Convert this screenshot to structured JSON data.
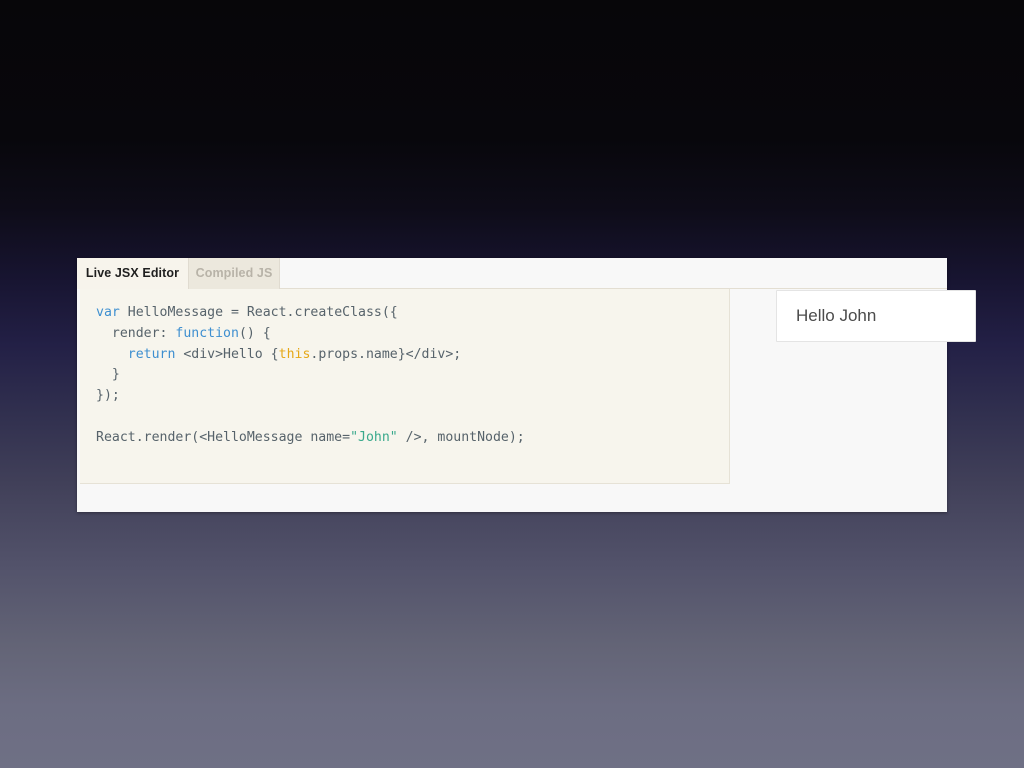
{
  "slide": {
    "background_top_color": "#070609",
    "background_bottom_color": "#6f7085"
  },
  "editor": {
    "tabs": [
      {
        "label": "Live JSX Editor",
        "active": true
      },
      {
        "label": "Compiled JS",
        "active": false
      }
    ],
    "code_pane": {
      "background_color": "#f7f5ed",
      "lines": [
        "var HelloMessage = React.createClass({",
        "  render: function() {",
        "    return <div>Hello {this.props.name}</div>;",
        "  }",
        "});",
        "",
        "React.render(<HelloMessage name=\"John\" />, mountNode);"
      ],
      "syntax_colors": {
        "keyword": "#3e8fd0",
        "this": "#e6a817",
        "string": "#3aa98c",
        "plain": "#57636b"
      },
      "tokens": {
        "kw_var": "var",
        "kw_function": "function",
        "kw_return": "return",
        "this_token": "this",
        "string_john": "\"John\""
      },
      "code_segments": {
        "line1_after_var": " HelloMessage = React.createClass({",
        "line2_before_fn": "  render: ",
        "line2_after_fn": "() {",
        "line3_before_return": "    ",
        "line3_after_return": " <div>Hello {",
        "line3_after_this": ".props.name}</div>;",
        "line4": "  }",
        "line5": "});",
        "line6": "",
        "line7_before_str": "React.render(<HelloMessage name=",
        "line7_after_str": " />, mountNode);"
      }
    },
    "output_pane": {
      "result_text": "Hello John",
      "result_background": "#ffffff"
    }
  }
}
